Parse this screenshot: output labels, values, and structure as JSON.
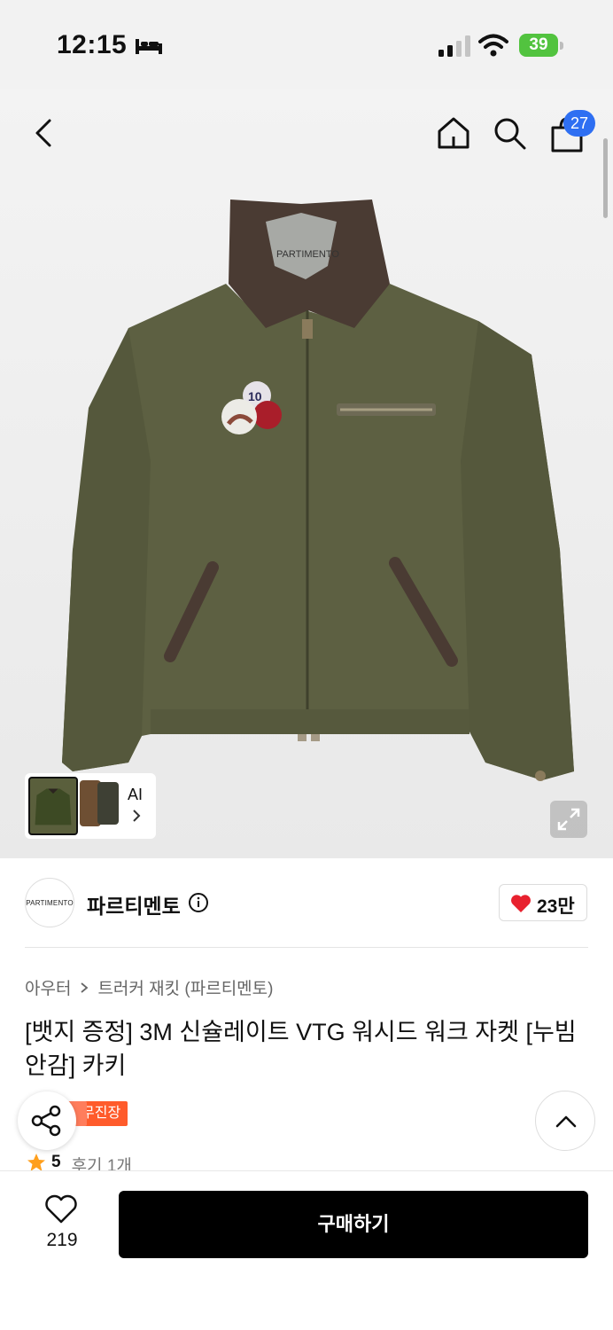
{
  "status_bar": {
    "time": "12:15",
    "battery": "39"
  },
  "header": {
    "cart_count": "27"
  },
  "gallery": {
    "ai_label": "AI"
  },
  "brand": {
    "logo_text": "PARTIMENTO",
    "name": "파르티멘토",
    "likes": "23만"
  },
  "breadcrumb": {
    "category": "아우터",
    "subcategory": "트러커 재킷 (파르티멘토)"
  },
  "product": {
    "title": "[뱃지 증정] 3M 신슐레이트 VTG 워시드 워크 자켓 [누빔 안감] 카키",
    "tag": "무진장",
    "rating": "5",
    "reviews": "후기 1개"
  },
  "bottom_bar": {
    "wish_count": "219",
    "buy_label": "구매하기"
  },
  "colors": {
    "accent_blue": "#2e6ff2",
    "tag_orange": "#ff5b2b",
    "heart_red": "#e8212e",
    "battery_green": "#52c33f"
  }
}
